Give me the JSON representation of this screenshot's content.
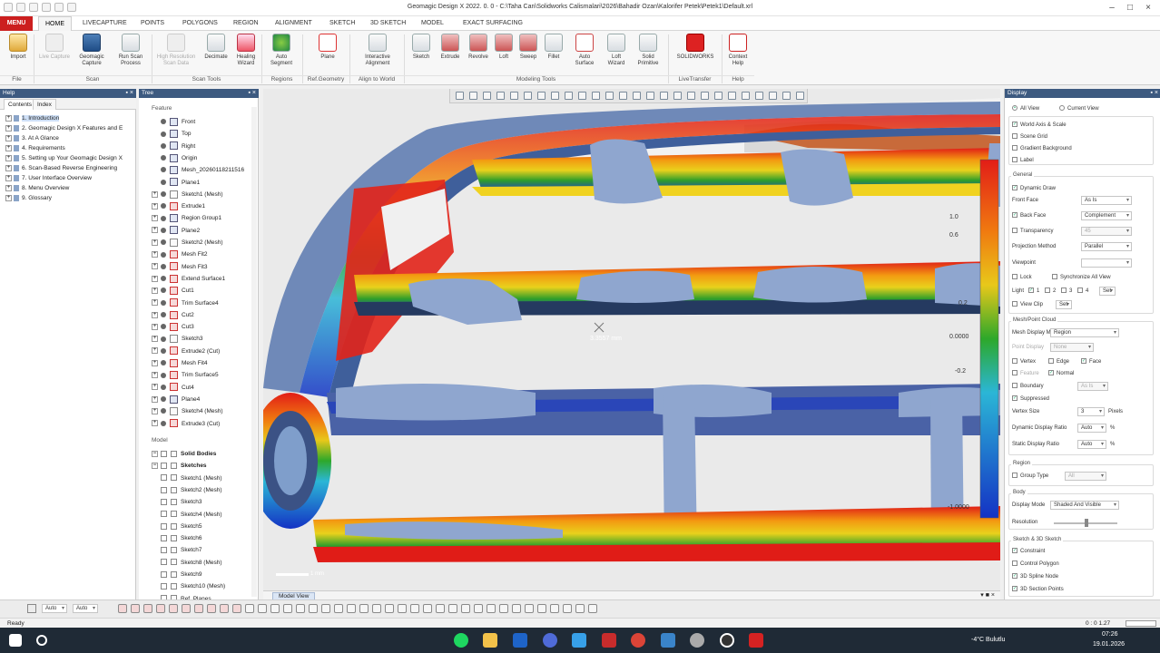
{
  "window": {
    "title": "Geomagic Design X 2022. 0. 0 - C:\\Taha Can\\Solidworks Calismalari\\2026\\Bahadir Ozan\\Kalorifer Petek\\Petek1\\Default.xrl"
  },
  "menu": {
    "label": "MENU"
  },
  "tabs": [
    "HOME",
    "LIVECAPTURE",
    "POINTS",
    "POLYGONS",
    "REGION",
    "ALIGNMENT",
    "SKETCH",
    "3D SKETCH",
    "MODEL",
    "EXACT SURFACING"
  ],
  "ribbon": {
    "buttons": [
      {
        "l1": "Import",
        "l2": ""
      },
      {
        "l1": "Live Capture",
        "l2": ""
      },
      {
        "l1": "Geomagic",
        "l2": "Capture"
      },
      {
        "l1": "Run Scan",
        "l2": "Process"
      },
      {
        "l1": "High Resolution",
        "l2": "Scan Data"
      },
      {
        "l1": "Decimate",
        "l2": ""
      },
      {
        "l1": "Healing",
        "l2": "Wizard"
      },
      {
        "l1": "Auto",
        "l2": "Segment"
      },
      {
        "l1": "Plane",
        "l2": ""
      },
      {
        "l1": "Interactive",
        "l2": "Alignment"
      },
      {
        "l1": "Sketch",
        "l2": ""
      },
      {
        "l1": "Extrude",
        "l2": ""
      },
      {
        "l1": "Revolve",
        "l2": ""
      },
      {
        "l1": "Loft",
        "l2": ""
      },
      {
        "l1": "Sweep",
        "l2": ""
      },
      {
        "l1": "Fillet",
        "l2": ""
      },
      {
        "l1": "Auto",
        "l2": "Surface"
      },
      {
        "l1": "Loft",
        "l2": "Wizard"
      },
      {
        "l1": "Solid",
        "l2": "Primitive"
      },
      {
        "l1": "SOLIDWORKS",
        "l2": ""
      },
      {
        "l1": "Context",
        "l2": "Help"
      }
    ],
    "groups": [
      "File",
      "Scan",
      "Scan Tools",
      "Regions",
      "Ref.Geometry",
      "Align to World",
      "Modeling Tools",
      "LiveTransfer",
      "Help"
    ]
  },
  "help": {
    "title": "Help",
    "tabs": [
      "Contents",
      "Index"
    ],
    "items": [
      "1. Introduction",
      "2. Geomagic Design X Features and E",
      "3. At A Glance",
      "4. Requirements",
      "5. Setting up Your Geomagic Design X",
      "6. Scan-Based Reverse Engineering",
      "7. User Interface Overview",
      "8. Menu Overview",
      "9. Glossary"
    ]
  },
  "tree": {
    "title": "Tree",
    "feature_label": "Feature",
    "model_label": "Model",
    "features": [
      "Front",
      "Top",
      "Right",
      "Origin",
      "Mesh_20260118211516",
      "Plane1",
      "Sketch1 (Mesh)",
      "Extrude1",
      "Region Group1",
      "Plane2",
      "Sketch2 (Mesh)",
      "Mesh Fit2",
      "Mesh Fit3",
      "Extend Surface1",
      "Cut1",
      "Trim Surface4",
      "Cut2",
      "Cut3",
      "Sketch3",
      "Extrude2 (Cut)",
      "Mesh Fit4",
      "Trim Surface5",
      "Cut4",
      "Plane4",
      "Sketch4 (Mesh)",
      "Extrude3 (Cut)"
    ],
    "model": [
      "Solid Bodies",
      "Sketches",
      "Sketch1 (Mesh)",
      "Sketch2 (Mesh)",
      "Sketch3",
      "Sketch4 (Mesh)",
      "Sketch5",
      "Sketch6",
      "Sketch7",
      "Sketch8 (Mesh)",
      "Sketch9",
      "Sketch10 (Mesh)",
      "Ref. Planes"
    ]
  },
  "viewport": {
    "tab_label": "Model View",
    "measure": "3.3557 mm",
    "scale_labels": [
      "1.0",
      "0.6",
      "0.2",
      "0.0000",
      "-0.2",
      "-1.0000"
    ],
    "scalebar_label": "1 mm"
  },
  "display": {
    "title": "Display",
    "view_options": [
      "All View",
      "Current View"
    ],
    "basic": [
      "World Axis & Scale",
      "Scene Grid",
      "Gradient Background",
      "Label"
    ],
    "general_label": "General",
    "dynamic_draw": "Dynamic Draw",
    "front_face": "Front Face",
    "front_face_val": "As Is",
    "back_face": "Back Face",
    "back_face_val": "Complement",
    "transparency": "Transparency",
    "transparency_val": "45",
    "projection": "Projection Method",
    "projection_val": "Parallel",
    "viewpoint": "Viewpoint",
    "lock": "Lock",
    "sync": "Synchronize All View",
    "light": "Light",
    "light_opts": [
      "1",
      "2",
      "3",
      "4"
    ],
    "set": "Set",
    "view_clip": "View Clip",
    "mesh_label": "Mesh/Point Cloud",
    "mesh_mode": "Mesh Display Mode",
    "mesh_mode_val": "Region",
    "point_display": "Point Display",
    "point_display_val": "None",
    "vertex": "Vertex",
    "edge": "Edge",
    "face": "Face",
    "feature": "Feature",
    "normal": "Normal",
    "boundary": "Boundary",
    "boundary_val": "As Is",
    "suppressed": "Suppressed",
    "vertex_size": "Vertex Size",
    "vertex_size_val": "3",
    "pixels": "Pixels",
    "dynamic_ratio": "Dynamic Display Ratio",
    "static_ratio": "Static Display Ratio",
    "ratio_val": "Auto",
    "percent": "%",
    "region_label": "Region",
    "group_type": "Group Type",
    "group_type_val": "All",
    "body_label": "Body",
    "body_mode": "Display Mode",
    "body_mode_val": "Shaded And Visible",
    "resolution": "Resolution",
    "sketch_label": "Sketch & 3D Sketch",
    "constraint": "Constraint",
    "control_polygon": "Control Polygon",
    "spline_node": "3D Spline Node",
    "section_points": "3D Section Points"
  },
  "bottom": {
    "auto1": "Auto",
    "auto2": "Auto"
  },
  "status": {
    "text": "Ready",
    "right": "0 : 0 1.27"
  },
  "taskbar": {
    "weather": "-4°C Bulutlu",
    "time": "07:26",
    "date": "19.01.2026"
  },
  "colors": {
    "accent": "#cc1f1f",
    "mesh_blue": "#7f9ecb",
    "panel_header": "#3d5a80"
  }
}
